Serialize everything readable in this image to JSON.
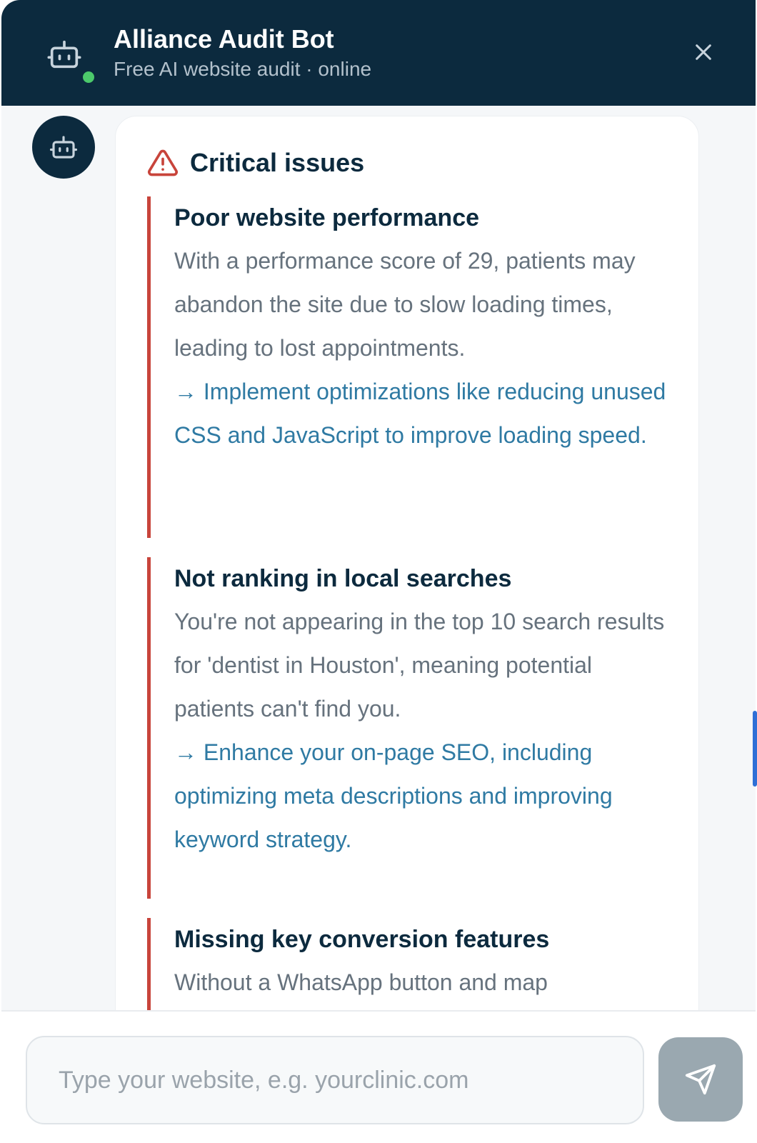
{
  "header": {
    "title": "Alliance Audit Bot",
    "subtitle": "Free AI website audit · online",
    "icon": "robot-icon",
    "close_icon": "close-icon"
  },
  "message": {
    "avatar_icon": "robot-icon",
    "section_icon": "warning-triangle-icon",
    "section_title": "Critical issues",
    "issues": [
      {
        "title": "Poor website performance",
        "description": "With a performance score of 29, patients may abandon the site due to slow loading times, leading to lost appointments.",
        "fix": "→ Implement optimizations like reducing unused CSS and JavaScript to improve loading speed."
      },
      {
        "title": "Not ranking in local searches",
        "description": "You're not appearing in the top 10 search results for 'dentist in Houston', meaning potential patients can't find you.",
        "fix": "→ Enhance your on-page SEO, including optimizing meta descriptions and improving keyword strategy."
      },
      {
        "title": "Missing key conversion features",
        "description": "Without a WhatsApp button and map",
        "fix": ""
      }
    ]
  },
  "composer": {
    "placeholder": "Type your website, e.g. yourclinic.com",
    "value": "",
    "send_icon": "send-icon"
  },
  "colors": {
    "header_bg": "#0c2a3e",
    "status_online": "#4cc96b",
    "issue_border": "#c8443b",
    "fix_text": "#2f7aa3",
    "send_button": "#9aa8b0"
  }
}
